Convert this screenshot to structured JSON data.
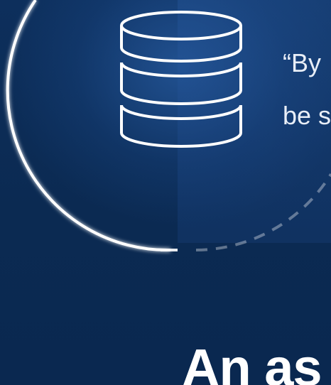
{
  "quote": {
    "line1": "“By",
    "line2": "be s"
  },
  "heading": {
    "text": "An as"
  },
  "icons": {
    "main": "database-icon"
  },
  "colors": {
    "background": "#0b2a52",
    "line": "#ffffff",
    "text": "#e8eef7"
  }
}
